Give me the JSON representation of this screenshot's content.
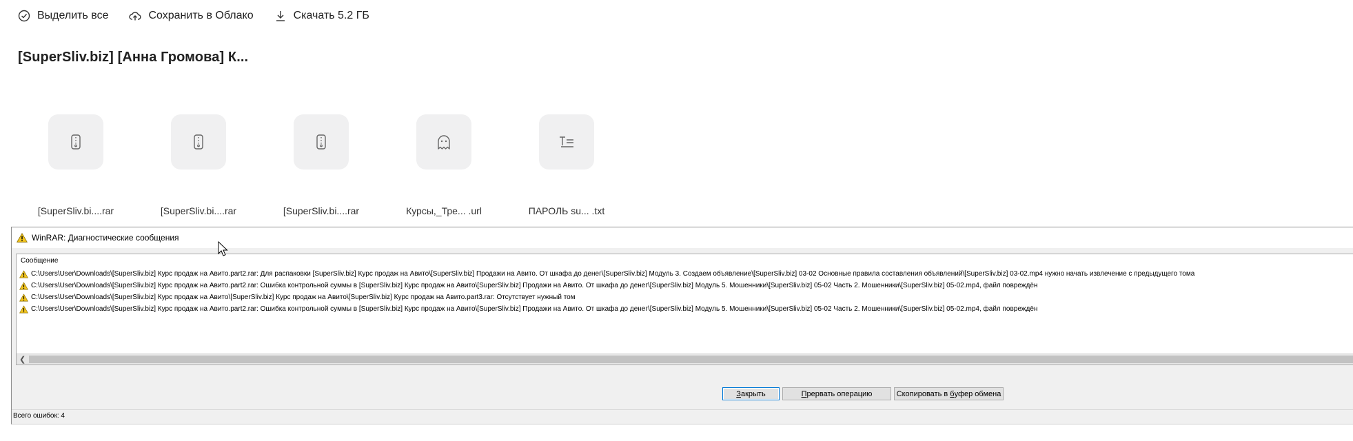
{
  "toolbar": {
    "select_all": "Выделить все",
    "save_cloud": "Сохранить в Облако",
    "download": "Скачать 5.2 ГБ"
  },
  "folder": {
    "title": "[SuperSliv.biz] [Анна Громова] К..."
  },
  "files": [
    {
      "name": "[SuperSliv.bi....rar",
      "icon": "archive-icon"
    },
    {
      "name": "[SuperSliv.bi....rar",
      "icon": "archive-icon"
    },
    {
      "name": "[SuperSliv.bi....rar",
      "icon": "archive-icon"
    },
    {
      "name": "Курсы,_Тре... .url",
      "icon": "ghost-icon"
    },
    {
      "name": "ПАРОЛЬ su... .txt",
      "icon": "text-file-icon"
    }
  ],
  "dialog": {
    "title": "WinRAR: Диагностические сообщения",
    "column_header": "Сообщение",
    "messages": [
      "C:\\Users\\User\\Downloads\\[SuperSliv.biz] Курс продаж на Авито.part2.rar: Для распаковки [SuperSliv.biz] Курс продаж на Авито\\[SuperSliv.biz] Продажи на Авито. От шкафа до денег\\[SuperSliv.biz] Модуль 3. Создаем объявление\\[SuperSliv.biz] 03-02 Основные правила составления объявлений\\[SuperSliv.biz] 03-02.mp4 нужно начать извлечение с предыдущего тома",
      "C:\\Users\\User\\Downloads\\[SuperSliv.biz] Курс продаж на Авито.part2.rar: Ошибка контрольной суммы в [SuperSliv.biz] Курс продаж на Авито\\[SuperSliv.biz] Продажи на Авито. От шкафа до денег\\[SuperSliv.biz] Модуль 5. Мошенники\\[SuperSliv.biz] 05-02 Часть 2. Мошенники\\[SuperSliv.biz] 05-02.mp4, файл повреждён",
      "C:\\Users\\User\\Downloads\\[SuperSliv.biz] Курс продаж на Авито\\[SuperSliv.biz] Курс продаж на Авито\\[SuperSliv.biz] Курс продаж на Авито.part3.rar: Отсутствует нужный том",
      "C:\\Users\\User\\Downloads\\[SuperSliv.biz] Курс продаж на Авито.part2.rar: Ошибка контрольной суммы в [SuperSliv.biz] Курс продаж на Авито\\[SuperSliv.biz] Продажи на Авито. От шкафа до денег\\[SuperSliv.biz] Модуль 5. Мошенники\\[SuperSliv.biz] 05-02 Часть 2. Мошенники\\[SuperSliv.biz] 05-02.mp4, файл повреждён"
    ],
    "buttons": {
      "close_key": "З",
      "close_rest": "акрыть",
      "abort_key": "П",
      "abort_rest": "рервать операцию",
      "copy_pre": "Скопировать в ",
      "copy_key": "б",
      "copy_rest": "уфер обмена"
    },
    "status": "Всего ошибок: 4"
  },
  "colors": {
    "warning_yellow": "#f4c61f",
    "default_button_border": "#0078d7",
    "tile_background": "#f0f0f1"
  }
}
